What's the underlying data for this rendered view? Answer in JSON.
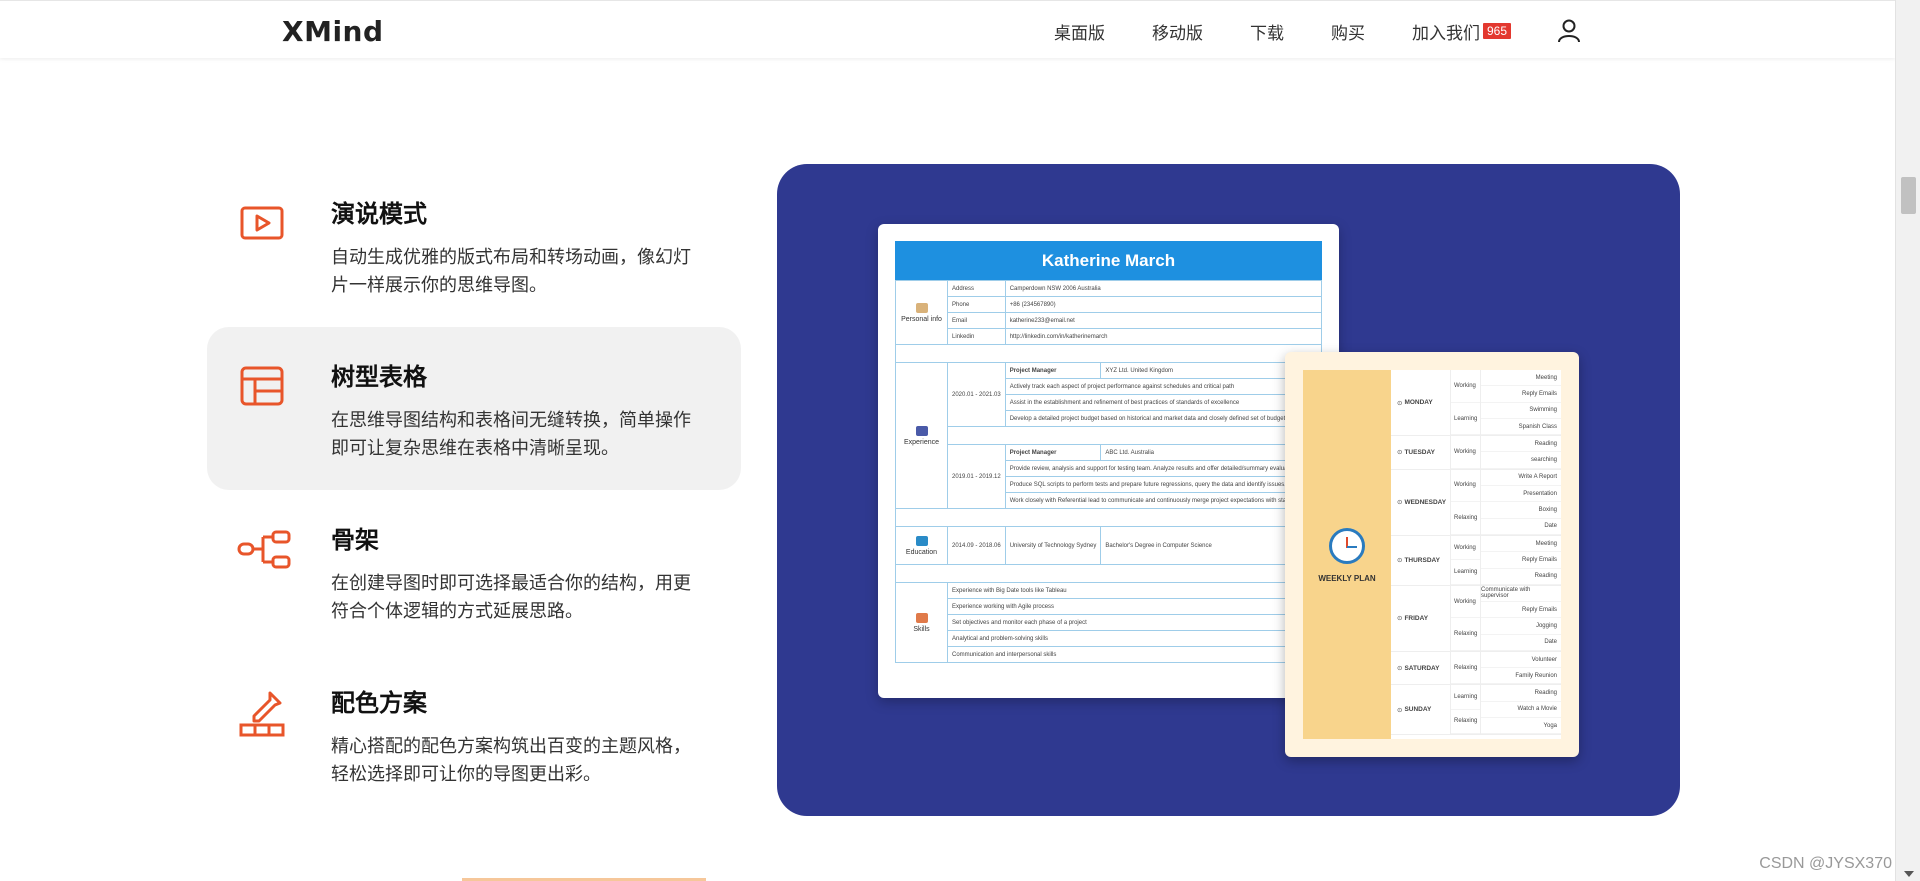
{
  "header": {
    "logo": "XMind",
    "nav": [
      {
        "label": "桌面版"
      },
      {
        "label": "移动版"
      },
      {
        "label": "下载"
      },
      {
        "label": "购买"
      },
      {
        "label": "加入我们",
        "badge": "965"
      }
    ],
    "user_icon": "user-icon"
  },
  "features": [
    {
      "icon": "play-icon",
      "title": "演说模式",
      "desc": "自动生成优雅的版式布局和转场动画，像幻灯片一样展示你的思维导图。",
      "active": false
    },
    {
      "icon": "table-layout-icon",
      "title": "树型表格",
      "desc": "在思维导图结构和表格间无缝转换，简单操作即可让复杂思维在表格中清晰呈现。",
      "active": true
    },
    {
      "icon": "skeleton-icon",
      "title": "骨架",
      "desc": "在创建导图时即可选择最适合你的结构，用更符合个体逻辑的方式延展思路。",
      "active": false
    },
    {
      "icon": "color-picker-icon",
      "title": "配色方案",
      "desc": "精心搭配的配色方案构筑出百变的主题风格，轻松选择即可让你的导图更出彩。",
      "active": false
    }
  ],
  "preview": {
    "resume": {
      "name": "Katherine March",
      "personal_info": {
        "section": "Personal info",
        "rows": [
          {
            "label": "Address",
            "value": "Camperdown NSW 2006 Australia"
          },
          {
            "label": "Phone",
            "value": "+86 (234567890)"
          },
          {
            "label": "Email",
            "value": "katherine233@email.net"
          },
          {
            "label": "Linkedin",
            "value": "http://linkedin.com/in/katherinemarch"
          }
        ]
      },
      "experience": {
        "section": "Experience",
        "jobs": [
          {
            "period": "2020.01 - 2021.03",
            "title": "Project Manager",
            "company": "XYZ Ltd. United Kingdom",
            "items": [
              "Actively track each aspect of project performance against schedules and critical path",
              "Assist in the establishment and refinement of best practices of standards of excellence",
              "Develop a detailed project budget based on historical and market data and closely defined set of budget a"
            ]
          },
          {
            "period": "2019.01 - 2019.12",
            "title": "Project Manager",
            "company": "ABC Ltd. Australia",
            "items": [
              "Provide review, analysis and support for testing team. Analyze results and offer detailed/summary evaluati",
              "Produce SQL scripts to perform tests and prepare future regressions, query the data and identify issues.",
              "Work closely with Referential lead to communicate and continuously merge project expectations with stak"
            ]
          }
        ]
      },
      "education": {
        "section": "Education",
        "period": "2014.09 - 2018.06",
        "school": "University of Technology Sydney",
        "degree": "Bachelor's Degree in Computer Science"
      },
      "skills": {
        "section": "Skills",
        "items": [
          "Experience with Big Date tools like Tableau",
          "Experience working with Agile process",
          "Set objectives and monitor each phase of a project",
          "Analytical and problem-solving skills",
          "Communication and interpersonal skills"
        ]
      }
    },
    "weekly_plan": {
      "title": "WEEKLY PLAN",
      "days": [
        {
          "day": "MONDAY",
          "cats": [
            "Working",
            "Learning"
          ],
          "items": [
            "Meeting",
            "Reply Emails",
            "Swimming",
            "Spanish Class"
          ]
        },
        {
          "day": "TUESDAY",
          "cats": [
            "Working"
          ],
          "items": [
            "Reading",
            "searching"
          ]
        },
        {
          "day": "WEDNESDAY",
          "cats": [
            "Working",
            "Relaxing"
          ],
          "items": [
            "Write A Report",
            "Presentation",
            "Boxing",
            "Date"
          ]
        },
        {
          "day": "THURSDAY",
          "cats": [
            "Working",
            "Learning"
          ],
          "items": [
            "Meeting",
            "Reply Emails",
            "Reading"
          ]
        },
        {
          "day": "FRIDAY",
          "cats": [
            "Working",
            "Relaxing"
          ],
          "items": [
            "Communicate with supervisor",
            "Reply Emails",
            "Jogging",
            "Date"
          ]
        },
        {
          "day": "SATURDAY",
          "cats": [
            "Relaxing"
          ],
          "items": [
            "Volunteer",
            "Family Reunion"
          ]
        },
        {
          "day": "SUNDAY",
          "cats": [
            "Learning",
            "Relaxing"
          ],
          "items": [
            "Reading",
            "Watch a Movie",
            "Yoga"
          ]
        }
      ]
    }
  },
  "watermark": "CSDN @JYSX370",
  "colors": {
    "accent": "#e8552a",
    "panel": "#2f3990",
    "resume_header": "#1e90e0",
    "plan_left": "#f8d48c",
    "badge": "#e3382f"
  }
}
